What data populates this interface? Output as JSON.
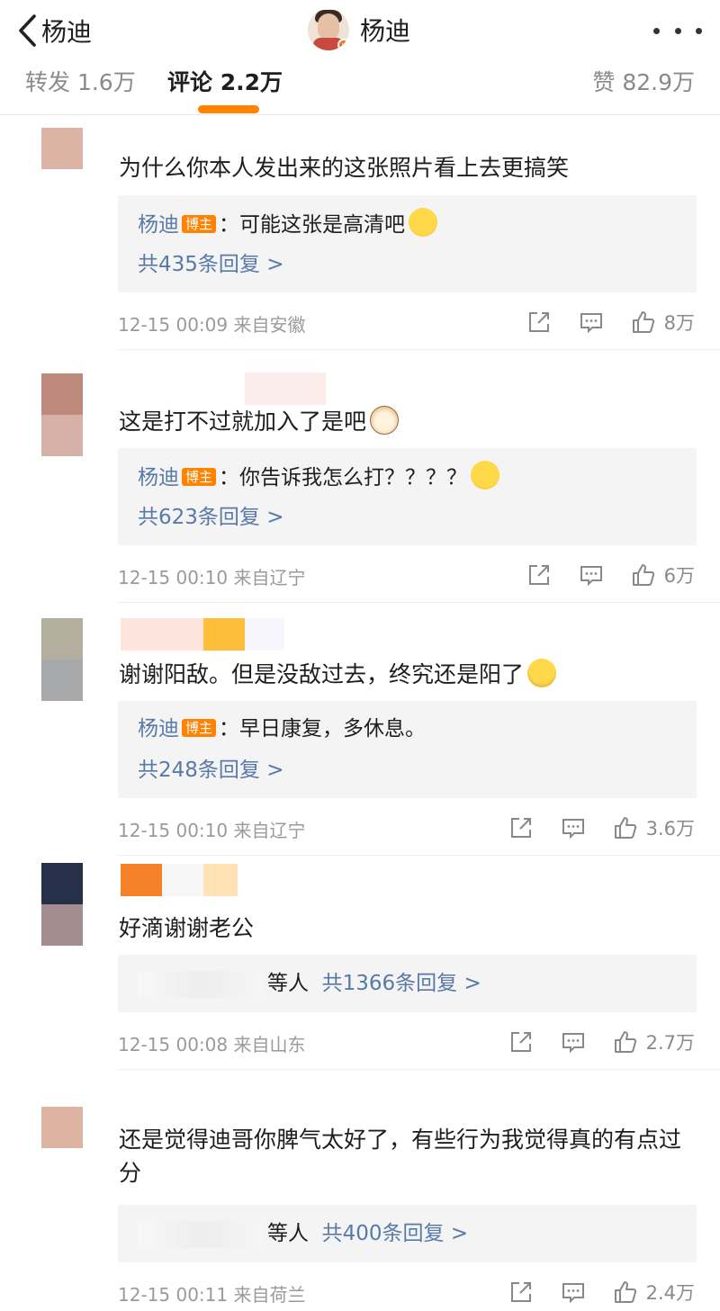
{
  "header": {
    "back_label": "杨迪",
    "title": "杨迪",
    "verified_badge": "v"
  },
  "tabs": {
    "repost": "转发 1.6万",
    "comment": "评论 2.2万",
    "like": "赞 82.9万"
  },
  "host_badge": "博主",
  "comments": [
    {
      "text": "为什么你本人发出来的这张照片看上去更搞笑",
      "reply_author": "杨迪",
      "reply_text": "：可能这张是高清吧",
      "reply_emoji": "laugh-cry-emoji",
      "reply_count": "共435条回复 >",
      "meta": "12-15 00:09  来自安徽",
      "likes": "8万"
    },
    {
      "text": "这是打不过就加入了是吧",
      "text_emoji": "cat-emoji",
      "reply_author": "杨迪",
      "reply_text": "：你告诉我怎么打？？？？",
      "reply_emoji": "laugh-cry-emoji",
      "reply_count": "共623条回复 >",
      "meta": "12-15 00:10  来自辽宁",
      "likes": "6万"
    },
    {
      "text": "谢谢阳敌。但是没敌过去，终究还是阳了",
      "text_emoji": "sick-emoji",
      "reply_author": "杨迪",
      "reply_text": "：早日康复，多休息。",
      "reply_count": "共248条回复 >",
      "meta": "12-15 00:10  来自辽宁",
      "likes": "3.6万"
    },
    {
      "text": "好滴谢谢老公",
      "reply_suffix": "等人",
      "reply_count": "共1366条回复 >",
      "meta": "12-15 00:08  来自山东",
      "likes": "2.7万"
    },
    {
      "text": "还是觉得迪哥你脾气太好了，有些行为我觉得真的有点过分",
      "reply_suffix": "等人",
      "reply_count": "共400条回复 >",
      "meta": "12-15 00:11  来自荷兰",
      "likes": "2.4万"
    }
  ],
  "colors": {
    "accent": "#ff8200",
    "link": "#587aa8",
    "meta": "#9a9a9a"
  },
  "icons": [
    "back-chevron-icon",
    "more-icon",
    "share-icon",
    "comment-icon",
    "like-icon"
  ]
}
